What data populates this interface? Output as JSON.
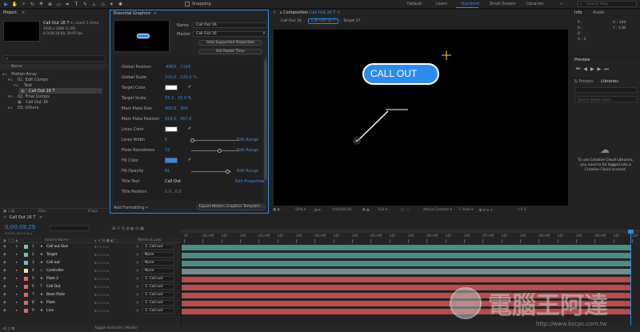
{
  "toolbar": {
    "tools": [
      "▲",
      "✋",
      "🔍",
      "↻",
      "⬚",
      "◻",
      "✒",
      "T",
      "✎",
      "⌫",
      "◆",
      "★"
    ],
    "snapping": "Snapping",
    "workspaces": [
      "Default",
      "Learn",
      "Standard",
      "Small Screen",
      "Libraries"
    ],
    "active_workspace": "Standard",
    "search_placeholder": "Search Help"
  },
  "project": {
    "tab": "Project",
    "item_name": "Call Out 16 T",
    "item_used": ", used 1 time",
    "item_info1": "1920 x 1080 (1.00)",
    "item_info2": "Δ 0;00;10;00, 29.97 fps",
    "col_header": "Name",
    "tree": [
      "Motion Array",
      "01. Edit Comps",
      "Text",
      "Call Out 16 T",
      "02. Final Comps",
      "Call Out 16",
      "03. Others"
    ],
    "bottom_bpc": "8 bpc",
    "files": "Files"
  },
  "eg": {
    "tab": "Essential Graphics",
    "name_label": "Name",
    "name_value": "Call Out 16",
    "master_label": "Master",
    "master_value": "Call Out 16",
    "solo_button": "Solo Supported Properties",
    "poster_button": "Set Poster Time",
    "props": [
      {
        "label": "Global Position",
        "value": "-6965 , 7193"
      },
      {
        "label": "Global Scale",
        "value": "100.0 , 100.0 %"
      },
      {
        "label": "Target Color",
        "value": ""
      },
      {
        "label": "Target Scale",
        "value": "33.3 , 33.3 %"
      },
      {
        "label": "Main Plate Size",
        "value": "450.0 , 300"
      },
      {
        "label": "Main Plate Position",
        "value": "918.0 , 467.0"
      },
      {
        "label": "Lines Color",
        "value": ""
      },
      {
        "label": "Lines Width",
        "value": "6"
      },
      {
        "label": "Plate Roundness",
        "value": "72"
      },
      {
        "label": "Fill Color",
        "value": ""
      },
      {
        "label": "Fill Opacity",
        "value": "91"
      },
      {
        "label": "Title Text",
        "value": "Call Out"
      },
      {
        "label": "Title Position",
        "value": "0.0 , 0.0"
      }
    ],
    "edit_range": "Edit Range",
    "edit_properties": "Edit Properties",
    "add_formatting": "Add Formatting",
    "export_button": "Export Motion Graphics Template...",
    "colors": {
      "target": "#ffffff",
      "lines": "#ffffff",
      "fill": "#2d8ceb"
    }
  },
  "comp": {
    "tab_prefix": "Composition",
    "tab_name": "Call Out 16 T",
    "flow": [
      "Call Out 16",
      "Call Out 16 T",
      "Target 17"
    ],
    "callout_text": "CALL OUT",
    "zoom": "50%",
    "timecode": "0;00;09;29",
    "resolution": "Full",
    "camera": "Active Camera",
    "view": "1 View",
    "exposure": "+0.0"
  },
  "info": {
    "tabs": [
      "Info",
      "Audio"
    ],
    "r": "R :",
    "g": "G :",
    "b": "B :",
    "a": "A : 0",
    "x": "X : 184",
    "y": "Y : 138"
  },
  "preview": {
    "tab": "Preview"
  },
  "libraries": {
    "tabs": [
      "& Presets",
      "Libraries"
    ],
    "search": "Search Adobe Stock",
    "message": "To use Creative Cloud Libraries, you need to be logged into a Creative Cloud account."
  },
  "timeline": {
    "tab": "Call Out 16 T",
    "timecode": "0;00;09;29",
    "timecode_sub": "00299 (29.97 fps)",
    "search_placeholder": "",
    "headers": {
      "source": "Source Name",
      "mode": "Mode",
      "trkmat": "T TrkMat",
      "parent": "Parent & Link"
    },
    "ruler": [
      "0f",
      "02:00f",
      "10f",
      "20f",
      "03:00f",
      "10f",
      "20f",
      "04:00f",
      "10f",
      "20f",
      "05:00f",
      "10f",
      "20f",
      "06:00f",
      "10f",
      "20f",
      "07:00f",
      "10f",
      "20f",
      "08:00f",
      "10f",
      "20f",
      "09:00f",
      "10f",
      "20f"
    ],
    "layers": [
      {
        "num": "1",
        "name": "Call out Size",
        "type": "★",
        "mode": "",
        "parent": "3. Call out",
        "color": "#7fbfb8"
      },
      {
        "num": "2",
        "name": "Target",
        "type": "★",
        "mode": "",
        "parent": "None",
        "color": "#7fbfb8"
      },
      {
        "num": "3",
        "name": "Call out",
        "type": "★",
        "mode": "",
        "parent": "None",
        "color": "#7fbfb8"
      },
      {
        "num": "4",
        "name": "Controller",
        "type": "▫",
        "mode": "",
        "parent": "None",
        "color": "#e8e8a0"
      },
      {
        "num": "5",
        "name": "Plate 2",
        "type": "★",
        "mode": "",
        "parent": "3. Call out",
        "color": "#d86a6a"
      },
      {
        "num": "6",
        "name": "Call Out",
        "type": "T",
        "mode": "",
        "parent": "3. Call out",
        "color": "#d86a6a"
      },
      {
        "num": "7",
        "name": "Base Plate",
        "type": "★",
        "mode": "",
        "parent": "3. Call out",
        "color": "#d86a6a"
      },
      {
        "num": "8",
        "name": "Plate",
        "type": "★",
        "mode": "",
        "parent": "3. Call out",
        "color": "#d86a6a"
      },
      {
        "num": "9",
        "name": "Line",
        "type": "★",
        "mode": "",
        "parent": "3. Call out",
        "color": "#d86a6a"
      }
    ],
    "toggle": "Toggle Switches / Modes"
  },
  "watermark": {
    "title": "電腦王阿達",
    "url": "http://www.kocpc.com.tw"
  }
}
